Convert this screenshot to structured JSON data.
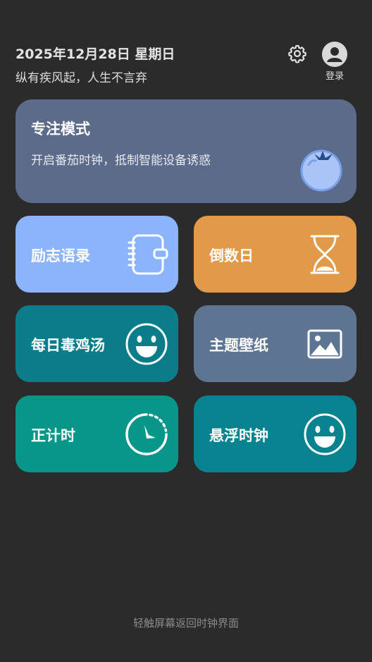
{
  "header": {
    "date": "2025年12月28日 星期日",
    "motto": "纵有疾风起，人生不言弃",
    "login_label": "登录"
  },
  "focus_card": {
    "title": "专注模式",
    "subtitle": "开启番茄时钟，抵制智能设备诱惑",
    "color": "#5b6b89"
  },
  "tiles": [
    {
      "label": "励志语录",
      "color": "#8cb4fd",
      "icon": "notebook-icon"
    },
    {
      "label": "倒数日",
      "color": "#e09a4a",
      "icon": "hourglass-icon"
    },
    {
      "label": "每日毒鸡汤",
      "color": "#0b7c89",
      "icon": "smiley-icon"
    },
    {
      "label": "主题壁纸",
      "color": "#5d7592",
      "icon": "image-icon"
    },
    {
      "label": "正计时",
      "color": "#089688",
      "icon": "stopwatch-icon"
    },
    {
      "label": "悬浮时钟",
      "color": "#07838f",
      "icon": "smiley-icon"
    }
  ],
  "footer": {
    "hint": "轻触屏幕返回时钟界面"
  }
}
